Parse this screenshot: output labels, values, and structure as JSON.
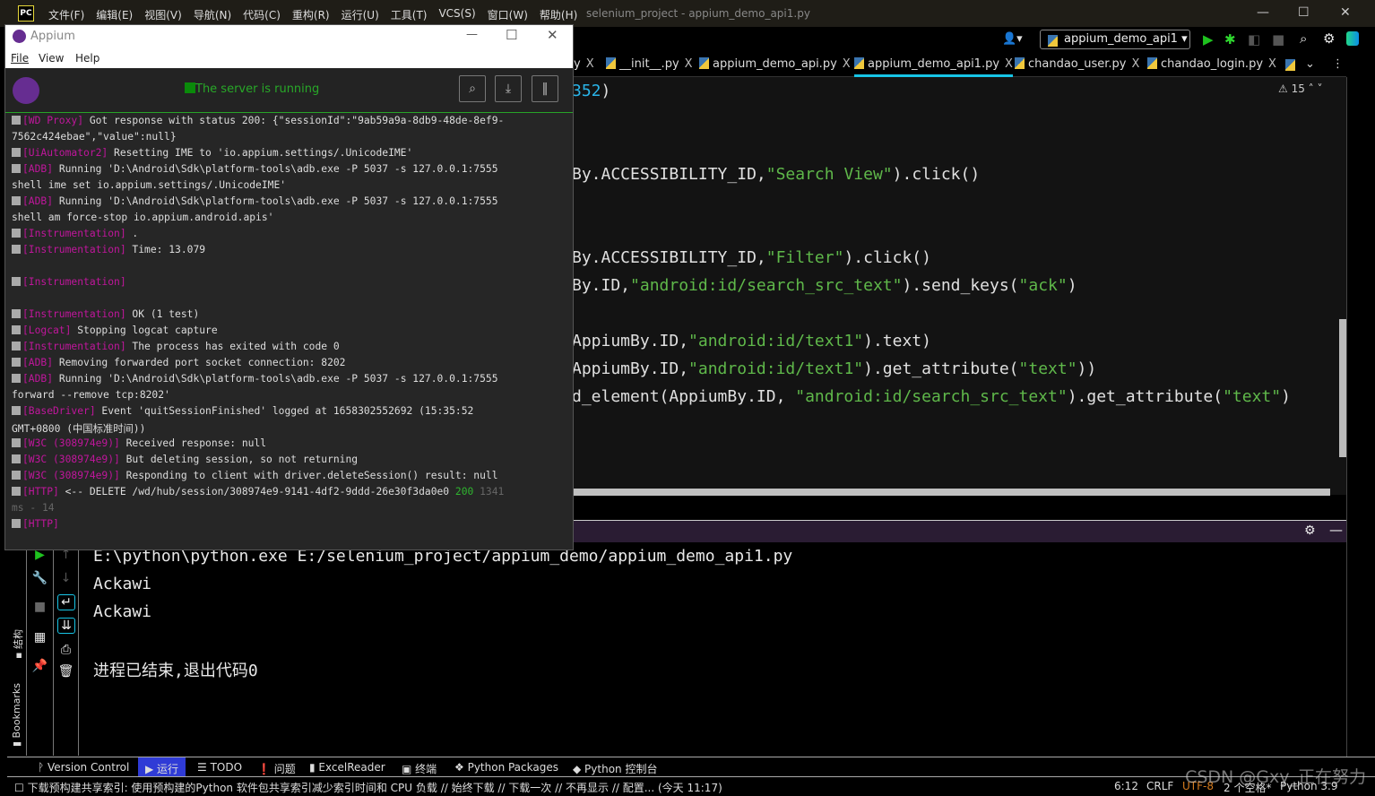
{
  "ide": {
    "title": "selenium_project - appium_demo_api1.py",
    "logo": "PC",
    "menu": [
      "文件(F)",
      "编辑(E)",
      "视图(V)",
      "导航(N)",
      "代码(C)",
      "重构(R)",
      "运行(U)",
      "工具(T)",
      "VCS(S)",
      "窗口(W)",
      "帮助(H)"
    ],
    "run_config": "appium_demo_api1",
    "tabs": [
      {
        "label": "y"
      },
      {
        "label": "__init__.py"
      },
      {
        "label": "appium_demo_api.py"
      },
      {
        "label": "appium_demo_api1.py",
        "active": true
      },
      {
        "label": "chandao_user.py"
      },
      {
        "label": "chandao_login.py"
      }
    ],
    "tab_close": "X",
    "warnings": "15",
    "code": [
      [
        {
          "t": "352",
          "k": "num"
        },
        {
          "t": ")",
          "k": ""
        }
      ],
      [
        {
          "t": "By.ACCESSIBILITY_ID,",
          "k": ""
        },
        {
          "t": "\"Search View\"",
          "k": "str"
        },
        {
          "t": ").click()",
          "k": ""
        }
      ],
      [
        {
          "t": "By.ACCESSIBILITY_ID,",
          "k": ""
        },
        {
          "t": "\"Filter\"",
          "k": "str"
        },
        {
          "t": ").click()",
          "k": ""
        }
      ],
      [
        {
          "t": "By.ID,",
          "k": ""
        },
        {
          "t": "\"android:id/search_src_text\"",
          "k": "str"
        },
        {
          "t": ").send_keys(",
          "k": ""
        },
        {
          "t": "\"ack\"",
          "k": "str"
        },
        {
          "t": ")",
          "k": ""
        }
      ],
      [
        {
          "t": "AppiumBy.ID,",
          "k": ""
        },
        {
          "t": "\"android:id/text1\"",
          "k": "str"
        },
        {
          "t": ").text)",
          "k": ""
        }
      ],
      [
        {
          "t": "AppiumBy.ID,",
          "k": ""
        },
        {
          "t": "\"android:id/text1\"",
          "k": "str"
        },
        {
          "t": ").get_attribute(",
          "k": ""
        },
        {
          "t": "\"text\"",
          "k": "str"
        },
        {
          "t": "))",
          "k": ""
        }
      ],
      [
        {
          "t": "d_element(AppiumBy.ID, ",
          "k": ""
        },
        {
          "t": "\"android:id/search_src_text\"",
          "k": "str"
        },
        {
          "t": ").get_attribute(",
          "k": ""
        },
        {
          "t": "\"text\"",
          "k": "str"
        },
        {
          "t": ")",
          "k": ""
        }
      ]
    ],
    "console": [
      "E:\\python\\python.exe E:/selenium_project/appium_demo/appium_demo_api1.py",
      "Ackawi",
      "Ackawi",
      "",
      "进程已结束,退出代码0"
    ],
    "side_labels": {
      "structure": "结构",
      "bookmarks": "Bookmarks"
    },
    "bottom_tools": [
      "Version Control",
      "运行",
      "TODO",
      "问题",
      "ExcelReader",
      "终端",
      "Python Packages",
      "Python 控制台"
    ],
    "status": {
      "message": "下载预构建共享索引: 使用预构建的Python 软件包共享索引减少索引时间和 CPU 负载 // 始终下载 // 下载一次 // 不再显示 // 配置... (今天 11:17)",
      "position": "6:12",
      "line_sep": "CRLF",
      "encoding": "UTF-8",
      "indent": "2 个空格*",
      "interpreter": "Python 3.9"
    },
    "watermark": "CSDN @Gxy_正在努力"
  },
  "appium": {
    "title": "Appium",
    "menu": [
      "File",
      "View",
      "Help"
    ],
    "status": "The server is running",
    "log": [
      {
        "tag": "[WD Proxy]",
        "text": " Got response with status 200: {\"sessionId\":\"9ab59a9a-8db9-48de-8ef9-"
      },
      {
        "text": "7562c424ebae\",\"value\":null}"
      },
      {
        "tag": "[UiAutomator2]",
        "text": " Resetting IME to 'io.appium.settings/.UnicodeIME'"
      },
      {
        "tag": "[ADB]",
        "text": " Running 'D:\\Android\\Sdk\\platform-tools\\adb.exe -P 5037 -s 127.0.0.1:7555"
      },
      {
        "text": "shell ime set io.appium.settings/.UnicodeIME'"
      },
      {
        "tag": "[ADB]",
        "text": " Running 'D:\\Android\\Sdk\\platform-tools\\adb.exe -P 5037 -s 127.0.0.1:7555"
      },
      {
        "text": "shell am force-stop io.appium.android.apis'"
      },
      {
        "tag": "[Instrumentation]",
        "text": " ."
      },
      {
        "tag": "[Instrumentation]",
        "text": " Time: 13.079"
      },
      {
        "text": ""
      },
      {
        "tag": "[Instrumentation]",
        "text": ""
      },
      {
        "text": ""
      },
      {
        "tag": "[Instrumentation]",
        "text": " OK (1 test)"
      },
      {
        "tag": "[Logcat]",
        "text": " Stopping logcat capture"
      },
      {
        "tag": "[Instrumentation]",
        "text": " The process has exited with code 0"
      },
      {
        "tag": "[ADB]",
        "text": " Removing forwarded port socket connection: 8202"
      },
      {
        "tag": "[ADB]",
        "text": " Running 'D:\\Android\\Sdk\\platform-tools\\adb.exe -P 5037 -s 127.0.0.1:7555"
      },
      {
        "text": "forward --remove tcp:8202'"
      },
      {
        "tag": "[BaseDriver]",
        "text": " Event 'quitSessionFinished' logged at 1658302552692 (15:35:52"
      },
      {
        "text": "GMT+0800 (中国标准时间))"
      },
      {
        "tag": "[W3C (308974e9)]",
        "text": " Received response: null"
      },
      {
        "tag": "[W3C (308974e9)]",
        "text": " But deleting session, so not returning"
      },
      {
        "tag": "[W3C (308974e9)]",
        "text": " Responding to client with driver.deleteSession() result: null"
      },
      {
        "tag": "[HTTP]",
        "text": " <-- DELETE /wd/hub/session/308974e9-9141-4df2-9ddd-26e30f3da0e0 ",
        "ok": "200",
        "dim": " 1341"
      },
      {
        "text": "",
        "dim": "ms - 14"
      },
      {
        "tag": "[HTTP]",
        "text": ""
      }
    ]
  },
  "colors": {
    "accent_tab": "#17c5e6",
    "run_active": "#2f3bd6",
    "log_tag": "#c0169c",
    "string": "#5fb84a",
    "appium_purple": "#662d91"
  }
}
